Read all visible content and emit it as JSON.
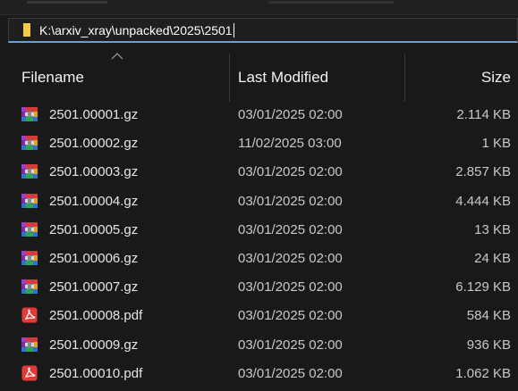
{
  "address_bar": {
    "path": "K:\\arxiv_xray\\unpacked\\2025\\2501"
  },
  "columns": {
    "name": "Filename",
    "modified": "Last Modified",
    "size": "Size",
    "sorted_by": "Filename"
  },
  "files": [
    {
      "name": "2501.00001.gz",
      "modified": "03/01/2025 02:00",
      "size": "2.114 KB",
      "icon": "archive-icon"
    },
    {
      "name": "2501.00002.gz",
      "modified": "11/02/2025 03:00",
      "size": "1 KB",
      "icon": "archive-icon"
    },
    {
      "name": "2501.00003.gz",
      "modified": "03/01/2025 02:00",
      "size": "2.857 KB",
      "icon": "archive-icon"
    },
    {
      "name": "2501.00004.gz",
      "modified": "03/01/2025 02:00",
      "size": "4.444 KB",
      "icon": "archive-icon"
    },
    {
      "name": "2501.00005.gz",
      "modified": "03/01/2025 02:00",
      "size": "13 KB",
      "icon": "archive-icon"
    },
    {
      "name": "2501.00006.gz",
      "modified": "03/01/2025 02:00",
      "size": "24 KB",
      "icon": "archive-icon"
    },
    {
      "name": "2501.00007.gz",
      "modified": "03/01/2025 02:00",
      "size": "6.129 KB",
      "icon": "archive-icon"
    },
    {
      "name": "2501.00008.pdf",
      "modified": "03/01/2025 02:00",
      "size": "584 KB",
      "icon": "pdf-icon"
    },
    {
      "name": "2501.00009.gz",
      "modified": "03/01/2025 02:00",
      "size": "936 KB",
      "icon": "archive-icon"
    },
    {
      "name": "2501.00010.pdf",
      "modified": "03/01/2025 02:00",
      "size": "1.062 KB",
      "icon": "pdf-icon"
    }
  ],
  "colors": {
    "background": "#191919",
    "accent": "#5ea3e0",
    "folder": "#f3c94b",
    "pdf": "#e23a3a"
  }
}
